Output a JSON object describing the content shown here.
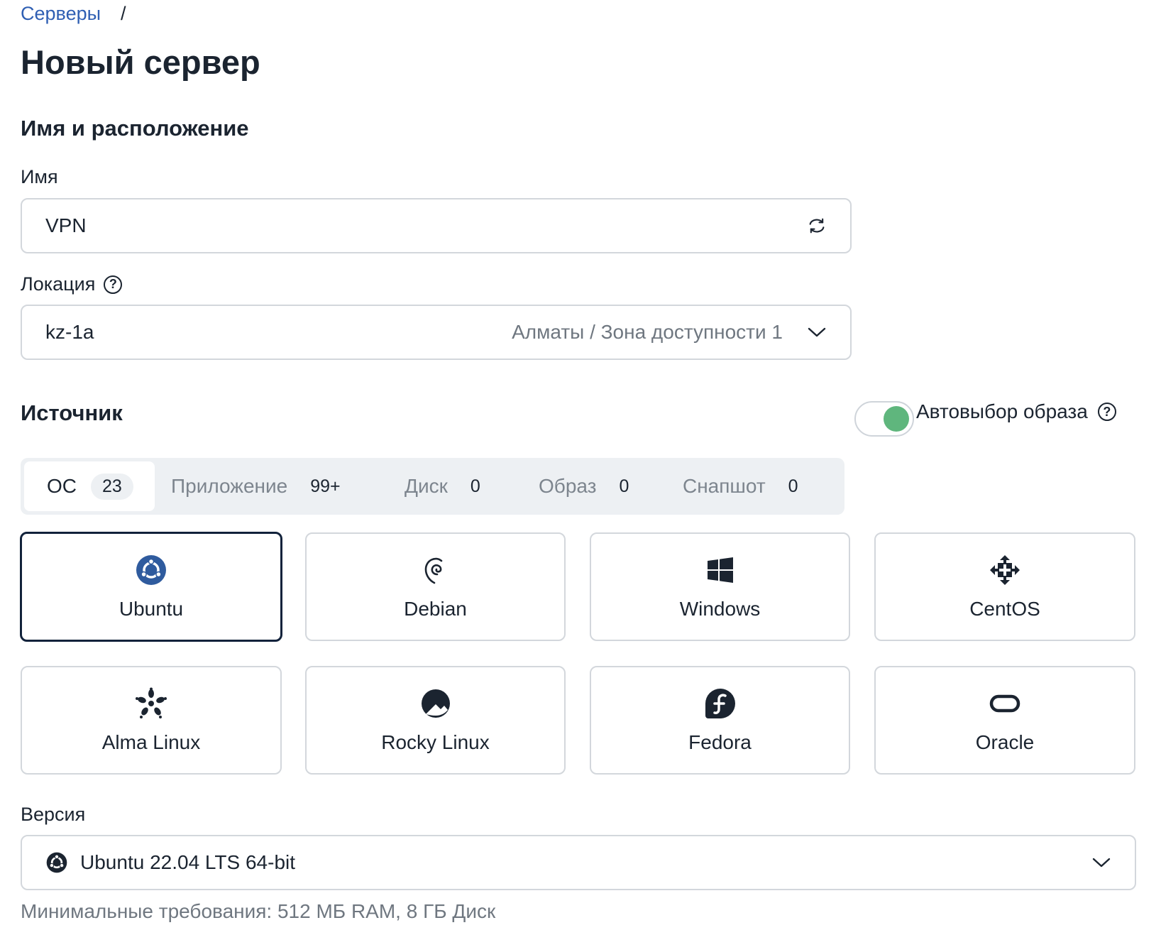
{
  "breadcrumb": {
    "link": "Серверы",
    "separator": "/"
  },
  "page_title": "Новый сервер",
  "name_location": {
    "section_title": "Имя и расположение",
    "name_label": "Имя",
    "name_value": "VPN",
    "location_label": "Локация",
    "location_value": "kz-1a",
    "location_hint": "Алматы / Зона доступности 1"
  },
  "source": {
    "section_title": "Источник",
    "auto_image_label": "Автовыбор образа",
    "auto_image_enabled": true,
    "tabs": [
      {
        "label": "ОС",
        "count": "23",
        "active": true
      },
      {
        "label": "Приложение",
        "count": "99+"
      },
      {
        "label": "Диск",
        "count": "0"
      },
      {
        "label": "Образ",
        "count": "0"
      },
      {
        "label": "Снапшот",
        "count": "0"
      }
    ],
    "os_options": [
      {
        "label": "Ubuntu",
        "icon": "ubuntu-icon",
        "selected": true
      },
      {
        "label": "Debian",
        "icon": "debian-icon"
      },
      {
        "label": "Windows",
        "icon": "windows-icon"
      },
      {
        "label": "CentOS",
        "icon": "centos-icon"
      },
      {
        "label": "Alma Linux",
        "icon": "alma-linux-icon"
      },
      {
        "label": "Rocky Linux",
        "icon": "rocky-linux-icon"
      },
      {
        "label": "Fedora",
        "icon": "fedora-icon"
      },
      {
        "label": "Oracle",
        "icon": "oracle-icon"
      }
    ]
  },
  "version": {
    "label": "Версия",
    "value": "Ubuntu 22.04 LTS 64-bit",
    "requirements": "Минимальные требования: 512 МБ RAM, 8 ГБ Диск"
  },
  "colors": {
    "link": "#2f5fb3",
    "toggle_on": "#5fb67d",
    "selected_border": "#12223b",
    "ubuntu": "#2f5b9e"
  }
}
